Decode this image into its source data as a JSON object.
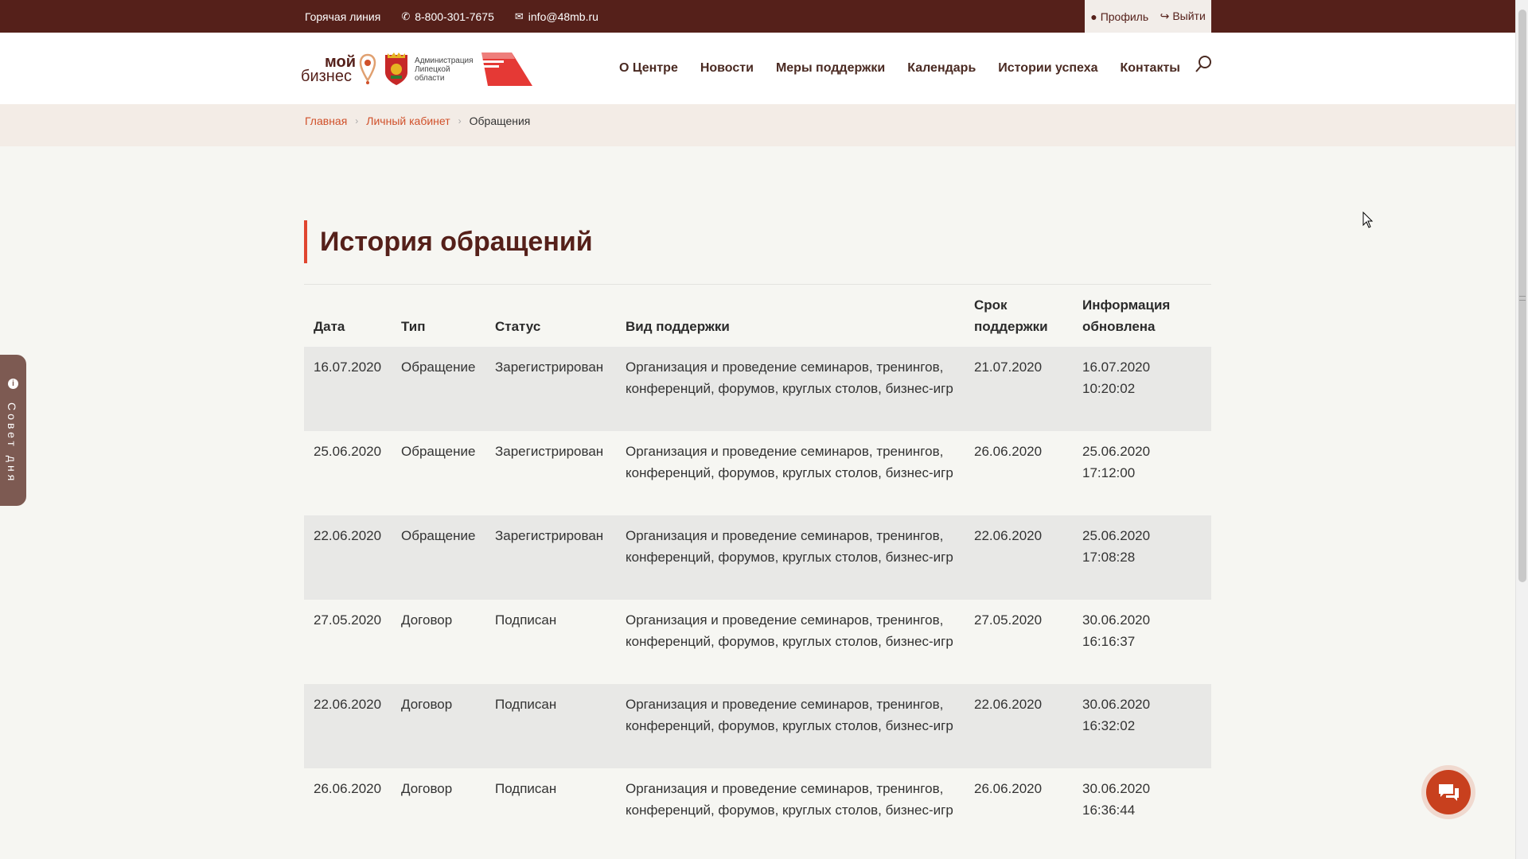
{
  "topbar": {
    "hotline_label": "Горячая линия",
    "phone": "8-800-301-7675",
    "email": "info@48mb.ru",
    "profile_label": "Профиль",
    "logout_label": "Выйти"
  },
  "header": {
    "logo_line1": "мой",
    "logo_line2": "бизнес",
    "admin_text": "Администрация Липецкой области",
    "nav": [
      "О Центре",
      "Новости",
      "Меры поддержки",
      "Календарь",
      "Истории успеха",
      "Контакты"
    ]
  },
  "breadcrumbs": {
    "home": "Главная",
    "cabinet": "Личный кабинет",
    "current": "Обращения"
  },
  "page_title": "История обращений",
  "table": {
    "headers": {
      "date": "Дата",
      "type": "Тип",
      "status": "Статус",
      "kind": "Вид поддержки",
      "term_l1": "Срок",
      "term_l2": "поддержки",
      "upd_l1": "Информация",
      "upd_l2": "обновлена"
    },
    "rows": [
      {
        "date": "16.07.2020",
        "type": "Обращение",
        "status": "Зарегистрирован",
        "kind": "Организация и проведение семинаров, тренингов, конференций, форумов, круглых столов, бизнес-игр",
        "term": "21.07.2020",
        "upd_date": "16.07.2020",
        "upd_time": "10:20:02"
      },
      {
        "date": "25.06.2020",
        "type": "Обращение",
        "status": "Зарегистрирован",
        "kind": "Организация и проведение семинаров, тренингов, конференций, форумов, круглых столов, бизнес-игр",
        "term": "26.06.2020",
        "upd_date": "25.06.2020",
        "upd_time": "17:12:00"
      },
      {
        "date": "22.06.2020",
        "type": "Обращение",
        "status": "Зарегистрирован",
        "kind": "Организация и проведение семинаров, тренингов, конференций, форумов, круглых столов, бизнес-игр",
        "term": "22.06.2020",
        "upd_date": "25.06.2020",
        "upd_time": "17:08:28"
      },
      {
        "date": "27.05.2020",
        "type": "Договор",
        "status": "Подписан",
        "kind": "Организация и проведение семинаров, тренингов, конференций, форумов, круглых столов, бизнес-игр",
        "term": "27.05.2020",
        "upd_date": "30.06.2020",
        "upd_time": "16:16:37"
      },
      {
        "date": "22.06.2020",
        "type": "Договор",
        "status": "Подписан",
        "kind": "Организация и проведение семинаров, тренингов, конференций, форумов, круглых столов, бизнес-игр",
        "term": "22.06.2020",
        "upd_date": "30.06.2020",
        "upd_time": "16:32:02"
      },
      {
        "date": "26.06.2020",
        "type": "Договор",
        "status": "Подписан",
        "kind": "Организация и проведение семинаров, тренингов, конференций, форумов, круглых столов, бизнес-игр",
        "term": "26.06.2020",
        "upd_date": "30.06.2020",
        "upd_time": "16:36:44"
      }
    ]
  },
  "side_tab": {
    "label": "Совет дня",
    "icon": "info-icon"
  },
  "chat": {
    "icon": "chat-icon"
  },
  "colors": {
    "brand_dark": "#55201a",
    "accent": "#e04630",
    "link": "#d0502a",
    "chat": "#c8401e"
  }
}
